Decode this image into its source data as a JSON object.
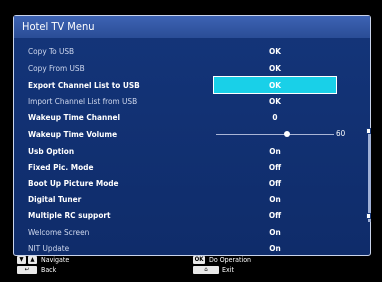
{
  "menu": {
    "title": "Hotel TV Menu",
    "items": [
      {
        "label": "Copy To USB",
        "value": "OK"
      },
      {
        "label": "Copy From USB",
        "value": "OK"
      },
      {
        "label": "Export Channel List to USB",
        "value": "OK"
      },
      {
        "label": "Import Channel List from USB",
        "value": "OK"
      },
      {
        "label": "Wakeup Time Channel",
        "value": "0"
      },
      {
        "label": "Wakeup Time Volume",
        "value": "60"
      },
      {
        "label": "Usb Option",
        "value": "On"
      },
      {
        "label": "Fixed Pic. Mode",
        "value": "Off"
      },
      {
        "label": "Boot Up Picture Mode",
        "value": "Off"
      },
      {
        "label": "Digital Tuner",
        "value": "On"
      },
      {
        "label": "Multiple RC support",
        "value": "Off"
      },
      {
        "label": "Welcome Screen",
        "value": "On"
      },
      {
        "label": "NIT Update",
        "value": "On"
      }
    ],
    "selected_index": 2,
    "wakeup_volume_level": 0.6
  },
  "footer": {
    "navigate": "Navigate",
    "back": "Back",
    "ok_key": "OK",
    "do_operation": "Do Operation",
    "exit": "Exit"
  }
}
